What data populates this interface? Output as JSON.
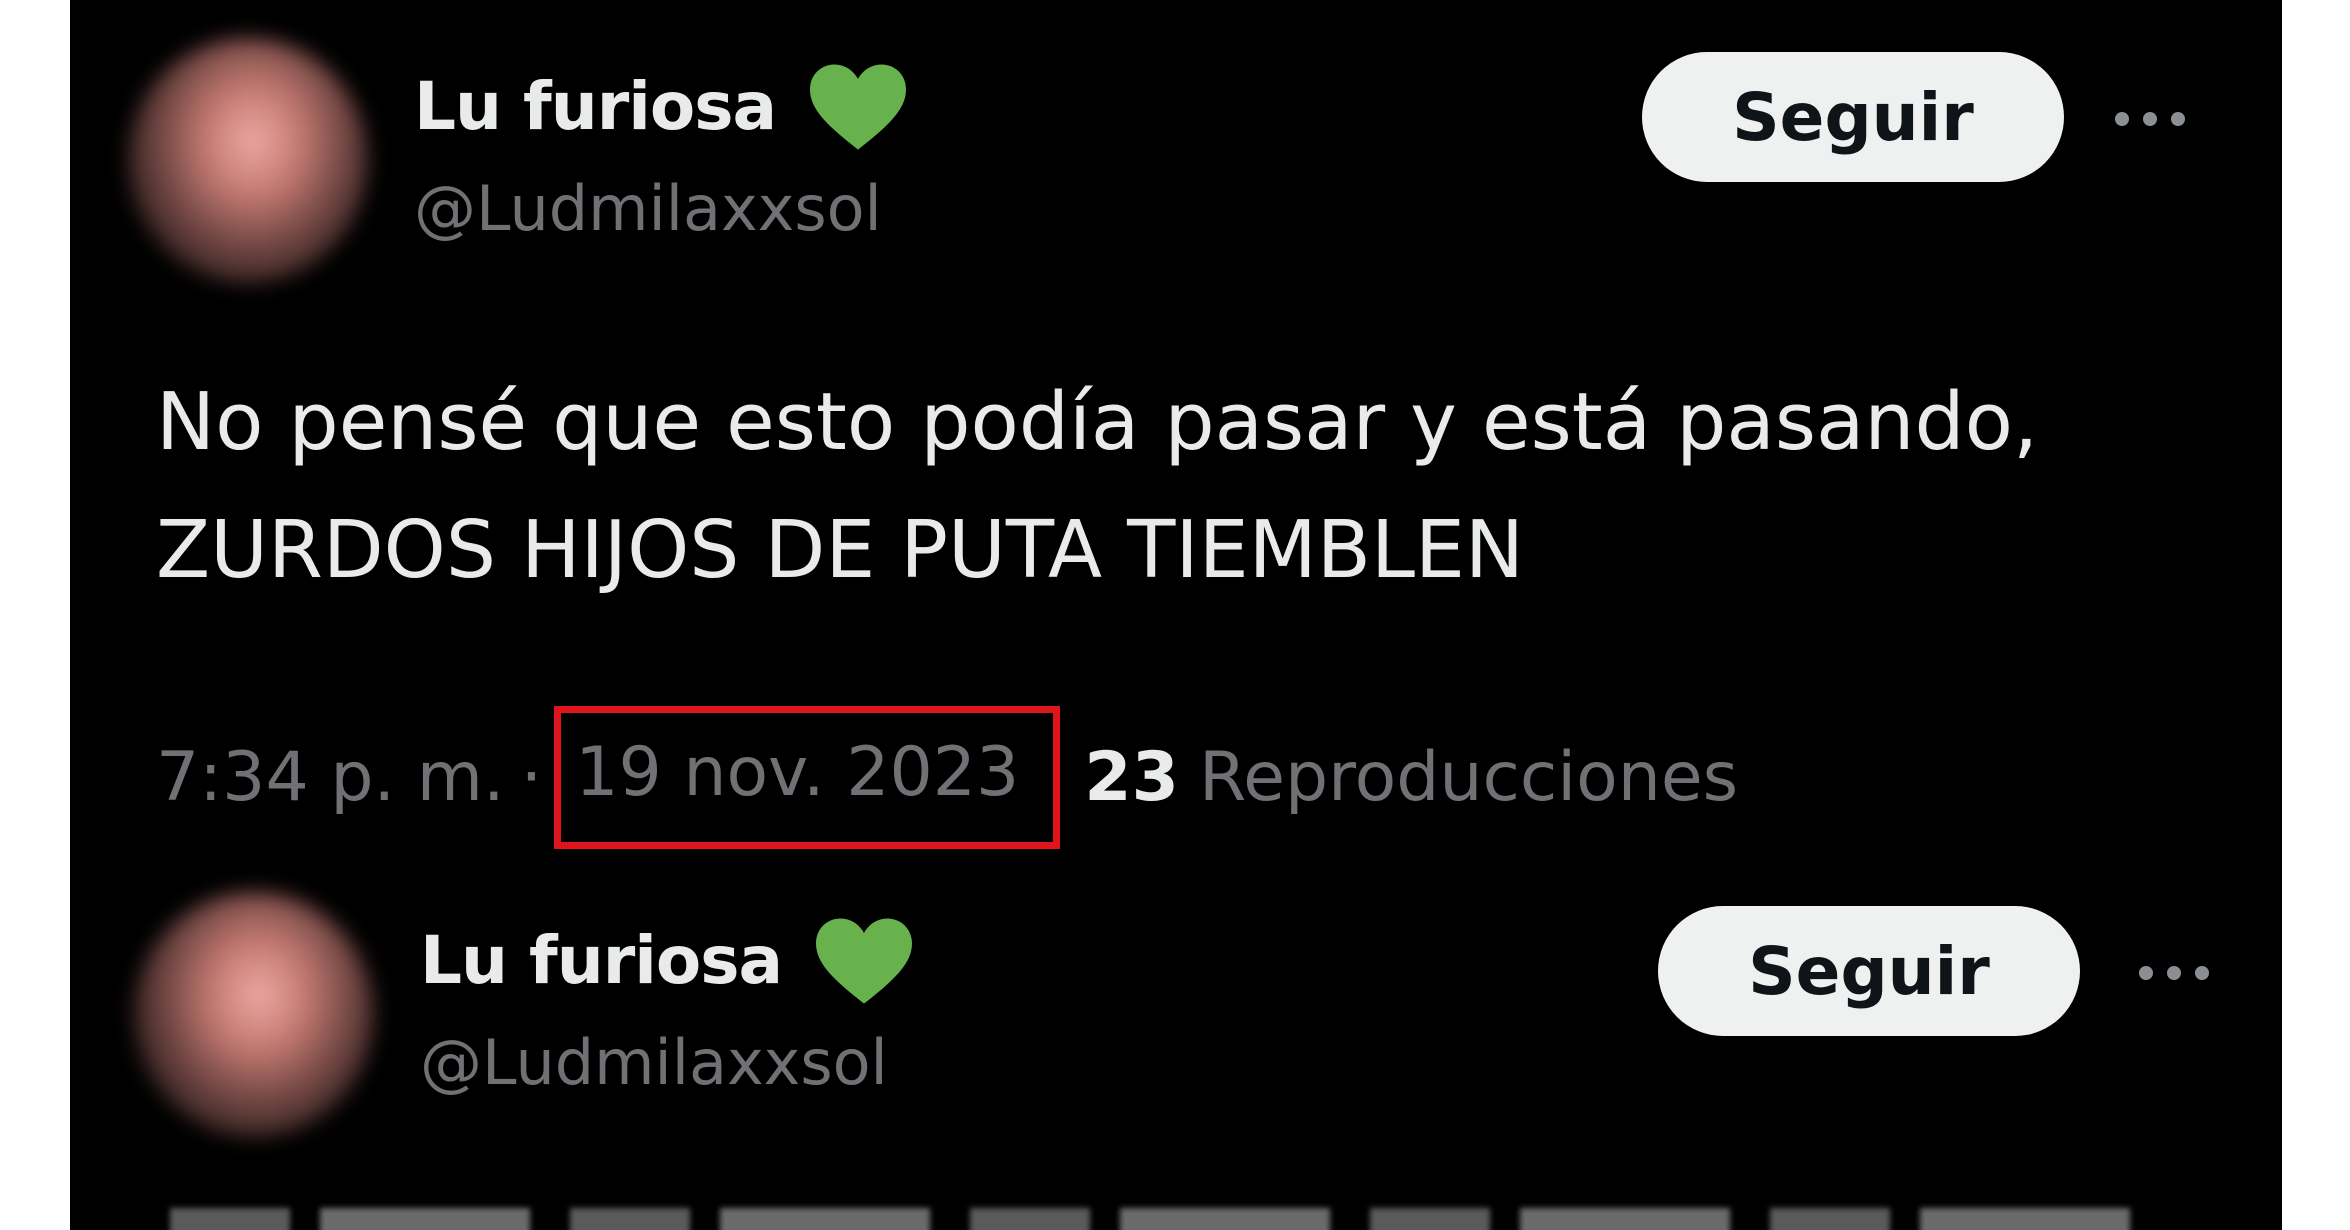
{
  "tweets": [
    {
      "author": {
        "name": "Lu furiosa",
        "handle": "@Ludmilaxxsol",
        "badge_icon": "green-heart-icon"
      },
      "follow_label": "Seguir",
      "more_icon": "more-dots-icon",
      "text": "No pensé que esto podía pasar y está pasando,\nZURDOS HIJOS DE PUTA TIEMBLEN",
      "time": "7:34 p. m.",
      "separator": "·",
      "date": "19 nov. 2023",
      "views_count": "23",
      "views_label": "Reproducciones"
    },
    {
      "author": {
        "name": "Lu furiosa",
        "handle": "@Ludmilaxxsol",
        "badge_icon": "green-heart-icon"
      },
      "follow_label": "Seguir",
      "more_icon": "more-dots-icon"
    }
  ],
  "colors": {
    "background": "#000000",
    "primary_text": "#e9eaea",
    "secondary_text": "#6f7175",
    "heart_green": "#67b24d",
    "follow_button_bg": "#eff1f1",
    "highlight_border": "#e0141b"
  }
}
